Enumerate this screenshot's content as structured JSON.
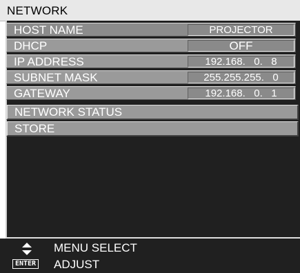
{
  "menu": {
    "title": "NETWORK"
  },
  "settings": [
    {
      "label": "HOST NAME",
      "value": "PROJECTOR"
    },
    {
      "label": "DHCP",
      "value": "OFF"
    },
    {
      "label": "IP ADDRESS",
      "value": "192.168.   0.   8"
    },
    {
      "label": "SUBNET MASK",
      "value": "255.255.255.   0"
    },
    {
      "label": "GATEWAY",
      "value": "192.168.   0.   1"
    }
  ],
  "actions": [
    {
      "label": "NETWORK STATUS"
    },
    {
      "label": "STORE"
    }
  ],
  "footer": {
    "menu_select_label": "MENU SELECT",
    "enter_key_label": "ENTER",
    "adjust_label": "ADJUST"
  },
  "icons": {
    "nav": "up-down-arrows-icon",
    "enter": "enter-key-icon"
  }
}
